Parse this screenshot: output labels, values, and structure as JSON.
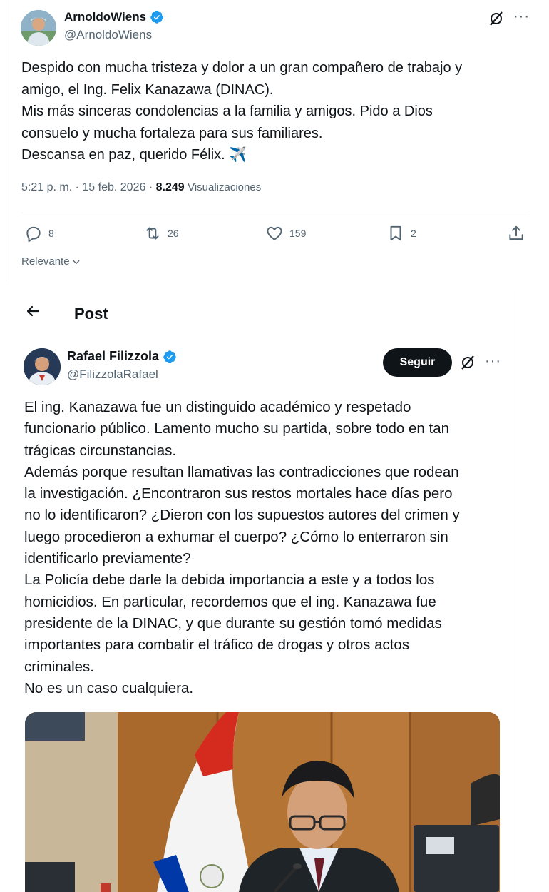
{
  "tweet1": {
    "author": {
      "name": "ArnoldoWiens",
      "handle": "@ArnoldoWiens",
      "verified": true
    },
    "more_label": "···",
    "text_lines": [
      "Despido con mucha tristeza y dolor a un gran compañero de trabajo y",
      "amigo, el Ing. Felix Kanazawa (DINAC).",
      "Mis más sinceras condolencias a la familia y amigos. Pido a Dios",
      "consuelo y mucha fortaleza para sus familiares.",
      "Descansa en paz, querido Félix. ✈️"
    ],
    "time": "5:21 p. m.",
    "date": "15 feb. 2026",
    "separator": "·",
    "views_count": "8.249",
    "views_label": "Visualizaciones",
    "actions": {
      "replies": "8",
      "reposts": "26",
      "likes": "159",
      "bookmarks": "2"
    },
    "sort_label": "Relevante"
  },
  "tweet2": {
    "header_title": "Post",
    "author": {
      "name": "Rafael Filizzola",
      "handle": "@FilizzolaRafael",
      "verified": true
    },
    "follow_label": "Seguir",
    "more_label": "···",
    "text_lines": [
      "El ing. Kanazawa fue un distinguido académico y respetado",
      "funcionario público. Lamento mucho su partida, sobre todo en tan",
      "trágicas circunstancias.",
      "Además porque resultan llamativas las contradicciones que rodean",
      "la investigación. ¿Encontraron sus restos mortales hace días pero",
      "no lo identificaron? ¿Dieron con los supuestos autores del crimen y",
      "luego procedieron a exhumar el cuerpo? ¿Cómo lo enterraron sin",
      "identificarlo previamente?",
      "La Policía debe darle la debida importancia a este y a todos los",
      "homicidios. En particular, recordemos que el ing. Kanazawa fue",
      "presidente de la DINAC, y que durante su gestión tomó medidas",
      "importantes para combatir el tráfico de drogas y otros actos",
      "criminales.",
      "No es un caso cualquiera."
    ]
  },
  "colors": {
    "text": "#0f1419",
    "secondary": "#536471",
    "verified": "#1d9bf0",
    "divider": "#eff3f4",
    "button_dark": "#0f1419"
  },
  "icons": {
    "verified": "verified-badge-icon",
    "grok": "grok-icon",
    "reply": "reply-icon",
    "repost": "repost-icon",
    "like": "heart-icon",
    "bookmark": "bookmark-icon",
    "share": "share-icon",
    "back": "back-arrow-icon",
    "chevron": "chevron-down-icon"
  }
}
